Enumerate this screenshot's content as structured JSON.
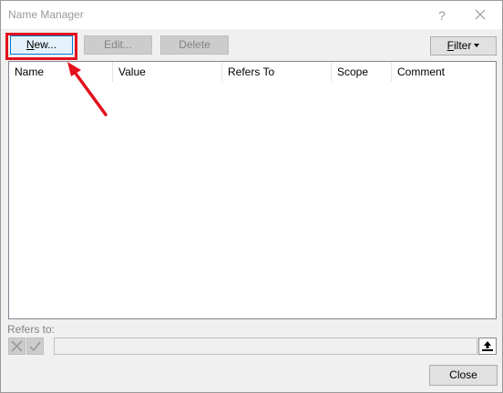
{
  "window": {
    "title": "Name Manager",
    "help_label": "?"
  },
  "toolbar": {
    "new_label": "ew...",
    "new_mnemonic": "N",
    "edit_label": "Edit...",
    "delete_label": "Delete",
    "filter_label": "ilter",
    "filter_mnemonic": "F"
  },
  "table": {
    "columns": [
      "Name",
      "Value",
      "Refers To",
      "Scope",
      "Comment"
    ],
    "rows": []
  },
  "refers_to": {
    "label": "Refers to:",
    "value": ""
  },
  "footer": {
    "close_label": "Close"
  },
  "colors": {
    "highlight": "#e3101d",
    "focus": "#0078d7"
  },
  "icons": {
    "cancel": "cancel-x-icon",
    "confirm": "checkmark-icon",
    "collapse": "collapse-dialog-icon",
    "close": "close-icon",
    "dropdown": "caret-down-icon",
    "annotation": "red-arrow-icon"
  }
}
